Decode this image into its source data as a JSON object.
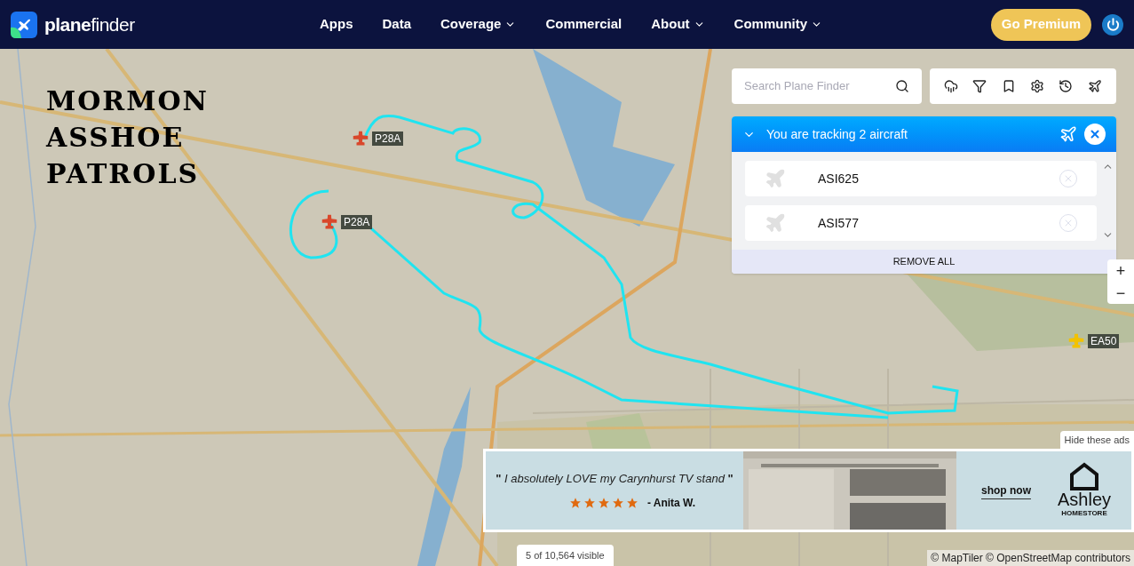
{
  "nav": {
    "logo_bold": "plane",
    "logo_light": "finder",
    "menu": [
      {
        "label": "Apps",
        "dropdown": false
      },
      {
        "label": "Data",
        "dropdown": false
      },
      {
        "label": "Coverage",
        "dropdown": true
      },
      {
        "label": "Commercial",
        "dropdown": false
      },
      {
        "label": "About",
        "dropdown": true
      },
      {
        "label": "Community",
        "dropdown": true
      }
    ],
    "premium_button": "Go Premium"
  },
  "overlay_caption": [
    "MORMON",
    "ASSHOE",
    "PATROLS"
  ],
  "aircraft_markers": [
    {
      "label": "P28A",
      "color": "#d9472b"
    },
    {
      "label": "P28A",
      "color": "#d9472b"
    },
    {
      "label": "EA50",
      "color": "#f2c200"
    }
  ],
  "search": {
    "placeholder": "Search Plane Finder"
  },
  "tracking": {
    "title": "You are tracking 2 aircraft",
    "expanded": true,
    "items": [
      "ASI625",
      "ASI577"
    ],
    "remove_all": "REMOVE ALL"
  },
  "zoom_controls": [
    "+",
    "−"
  ],
  "ad": {
    "hide": "Hide these ads",
    "quote": "**\"** *I absolutely LOVE my Carynhurst TV stand* **\"**",
    "stars": 5,
    "author": "- Anita W.",
    "cta": "shop now",
    "brand": "Ashley",
    "brand_sub": "HOMESTORE"
  },
  "visible_count": "5 of 10,564 visible",
  "attribution": "© MapTiler © OpenStreetMap contributors"
}
